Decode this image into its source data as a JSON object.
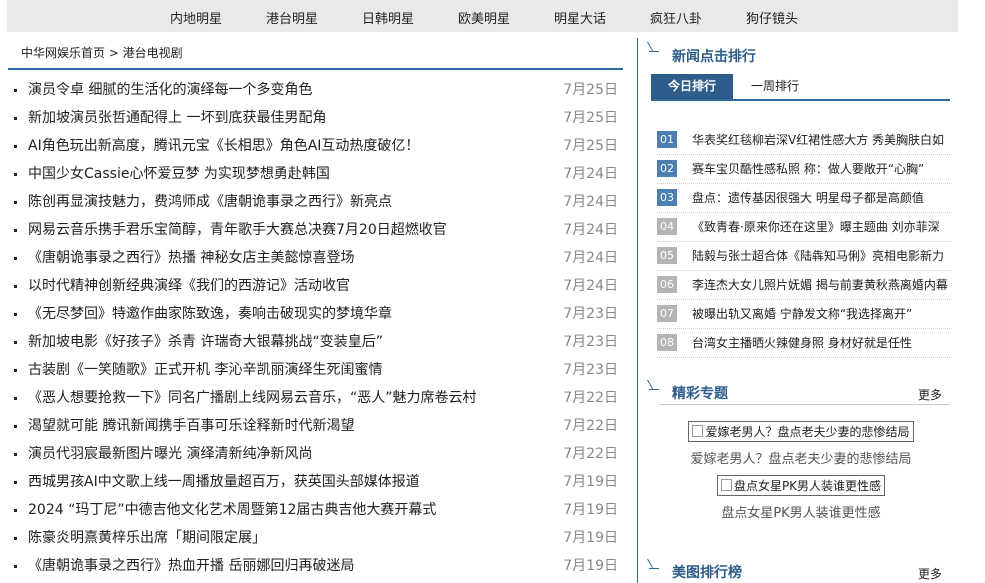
{
  "nav": {
    "items": [
      "内地明星",
      "港台明星",
      "日韩明星",
      "欧美明星",
      "明星大话",
      "疯狂八卦",
      "狗仔镜头"
    ]
  },
  "breadcrumb": "中华网娱乐首页 > 港台电视剧",
  "news": [
    {
      "title": "演员令卓 细腻的生活化的演绎每一个多变角色",
      "date": "7月25日"
    },
    {
      "title": "新加坡演员张哲通配得上 一坏到底获最佳男配角",
      "date": "7月25日"
    },
    {
      "title": "AI角色玩出新高度，腾讯元宝《长相思》角色AI互动热度破亿！",
      "date": "7月25日"
    },
    {
      "title": "中国少女Cassie心怀爱豆梦 为实现梦想勇赴韩国",
      "date": "7月24日"
    },
    {
      "title": "陈创再显演技魅力，费鸿师成《唐朝诡事录之西行》新亮点",
      "date": "7月24日"
    },
    {
      "title": "网易云音乐携手君乐宝简醇，青年歌手大赛总决赛7月20日超燃收官",
      "date": "7月24日"
    },
    {
      "title": "《唐朝诡事录之西行》热播 神秘女店主美懿惊喜登场",
      "date": "7月24日"
    },
    {
      "title": "以时代精神创新经典演绎《我们的西游记》活动收官",
      "date": "7月24日"
    },
    {
      "title": "《无尽梦回》特邀作曲家陈致逸，奏响击破现实的梦境华章",
      "date": "7月23日"
    },
    {
      "title": "新加坡电影《好孩子》杀青 许瑞奇大银幕挑战“变装皇后”",
      "date": "7月23日"
    },
    {
      "title": "古装剧《一笑随歌》正式开机 李沁辛凯丽演绎生死闺蜜情",
      "date": "7月23日"
    },
    {
      "title": "《恶人想要抢救一下》同名广播剧上线网易云音乐，“恶人”魅力席卷云村",
      "date": "7月22日"
    },
    {
      "title": "渴望就可能 腾讯新闻携手百事可乐诠释新时代新渴望",
      "date": "7月22日"
    },
    {
      "title": "演员代羽宸最新图片曝光 演绎清新纯净新风尚",
      "date": "7月22日"
    },
    {
      "title": "西城男孩AI中文歌上线一周播放量超百万，获英国头部媒体报道",
      "date": "7月19日"
    },
    {
      "title": "2024 “玛丁尼”中德吉他文化艺术周暨第12届古典吉他大赛开幕式",
      "date": "7月19日"
    },
    {
      "title": "陈豪炎明熹黄梓乐出席「期间限定展」",
      "date": "7月19日"
    },
    {
      "title": "《唐朝诡事录之西行》热血开播 岳丽娜回归再破迷局",
      "date": "7月19日"
    }
  ],
  "sidebar": {
    "ranking_title": "新闻点击排行",
    "tabs": [
      "今日排行",
      "一周排行"
    ],
    "ranking": [
      {
        "num": "01",
        "title": "华表奖红毯柳岩深V红裙性感大方 秀美胸肤白如"
      },
      {
        "num": "02",
        "title": "赛车宝贝酷性感私照 称：做人要敞开“心胸”"
      },
      {
        "num": "03",
        "title": "盘点：遗传基因很强大 明星母子都是高颜值"
      },
      {
        "num": "04",
        "title": "《致青春·原来你还在这里》曝主题曲 刘亦菲深"
      },
      {
        "num": "05",
        "title": "陆毅与张士超合体《陆犇知马俐》亮相电影新力"
      },
      {
        "num": "06",
        "title": "李连杰大女儿照片妩媚 揭与前妻黄秋燕离婚内幕"
      },
      {
        "num": "07",
        "title": "被曝出轨又离婚 宁静发文称“我选择离开”"
      },
      {
        "num": "08",
        "title": "台湾女主播晒火辣健身照 身材好就是任性"
      }
    ],
    "featured_title": "精彩专题",
    "featured_more": "更多",
    "featured": [
      {
        "alt": "爱嫁老男人？盘点老夫少妻的悲惨结局",
        "caption": "爱嫁老男人？盘点老夫少妻的悲惨结局"
      },
      {
        "alt": "盘点女星PK男人装谁更性感",
        "caption": "盘点女星PK男人装谁更性感"
      }
    ],
    "gallery_title": "美图排行榜",
    "gallery_more": "更多"
  },
  "colors": {
    "accent": "#2e6aa0",
    "title_blue": "#2e5d8c",
    "rank_top": "#4a7fb0",
    "rank_rest": "#b5b5b5"
  }
}
